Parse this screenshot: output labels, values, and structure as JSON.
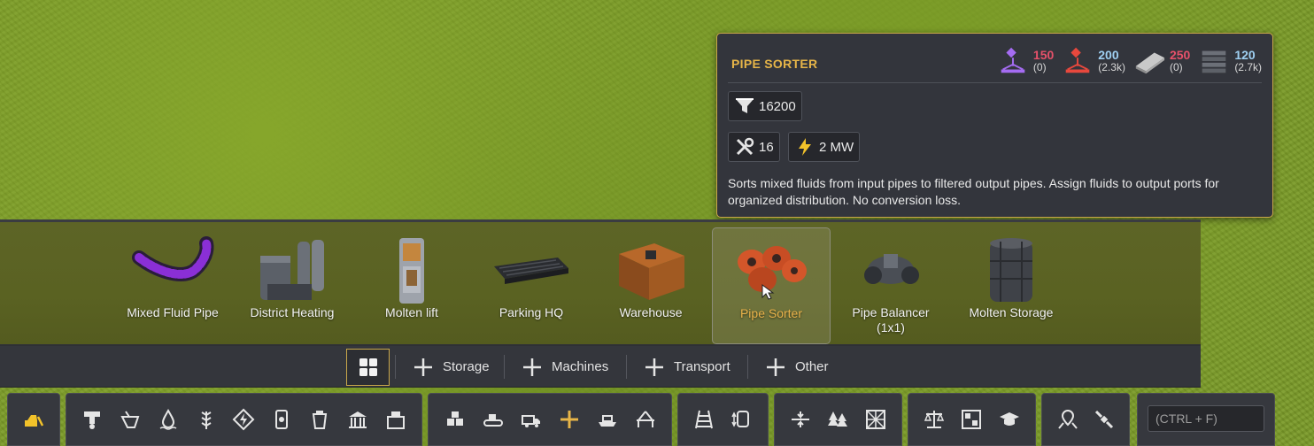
{
  "tooltip": {
    "title": "PIPE SORTER",
    "costs": [
      {
        "amount": "150",
        "stock": "(0)",
        "color": "#e6516a",
        "icon": "construction-parts-purple-icon"
      },
      {
        "amount": "200",
        "stock": "(2.3k)",
        "color": "#9fd0f2",
        "icon": "construction-parts-red-icon"
      },
      {
        "amount": "250",
        "stock": "(0)",
        "color": "#e6516a",
        "icon": "steel-plate-icon"
      },
      {
        "amount": "120",
        "stock": "(2.7k)",
        "color": "#9fd0f2",
        "icon": "metal-bars-icon"
      }
    ],
    "throughput": "16200",
    "workers": "16",
    "power": "2 MW",
    "description": "Sorts mixed fluids from input pipes to filtered output pipes. Assign fluids to output ports for organized distribution. No conversion loss."
  },
  "buildings": [
    {
      "label": "Mixed Fluid Pipe",
      "selected": false
    },
    {
      "label": "District Heating",
      "selected": false
    },
    {
      "label": "Molten lift",
      "selected": false
    },
    {
      "label": "Parking HQ",
      "selected": false
    },
    {
      "label": "Warehouse",
      "selected": false
    },
    {
      "label": "Pipe Sorter",
      "selected": true
    },
    {
      "label": "Pipe Balancer (1x1)",
      "selected": false
    },
    {
      "label": "Molten Storage",
      "selected": false
    }
  ],
  "categories": [
    "Storage",
    "Machines",
    "Transport",
    "Other"
  ],
  "search": {
    "placeholder": "(CTRL + F)"
  },
  "colors": {
    "accent": "#e7b548",
    "panel": "#34363c"
  }
}
